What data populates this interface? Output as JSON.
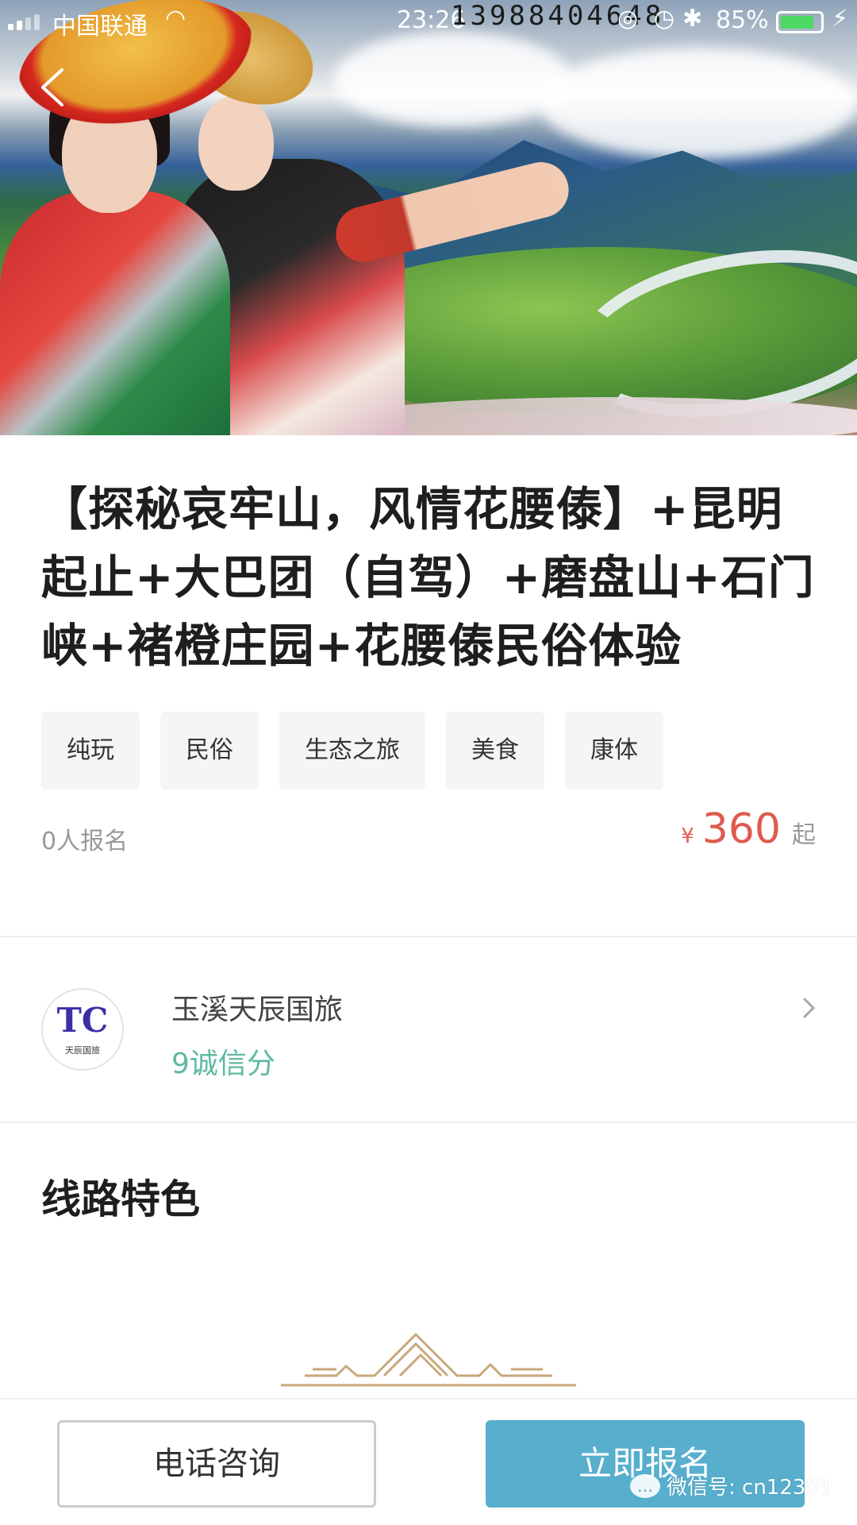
{
  "status_bar": {
    "carrier": "中国联通",
    "time": "23:26",
    "overlay_number": "13988404648",
    "battery": "85%",
    "battery_level": 0.85
  },
  "hero": {
    "back_icon": "chevron-left-icon"
  },
  "product": {
    "title": "【探秘哀牢山，风情花腰傣】+昆明起止+大巴团（自驾）+磨盘山+石门峡+褚橙庄园+花腰傣民俗体验",
    "tags": [
      "纯玩",
      "民俗",
      "生态之旅",
      "美食",
      "康体"
    ],
    "signup_count": "0人报名",
    "price": {
      "currency": "¥",
      "amount": "360",
      "suffix": "起"
    }
  },
  "agency": {
    "name": "玉溪天辰国旅",
    "score": "9诚信分",
    "logo_text": "天辰国旅",
    "logo_mark": "TC",
    "chevron_icon": "chevron-right-icon"
  },
  "features": {
    "title": "线路特色"
  },
  "bottom_bar": {
    "consult_label": "电话咨询",
    "signup_label": "立即报名"
  },
  "watermark": {
    "text": "微信号: cn12301"
  },
  "colors": {
    "price": "#e05a4e",
    "score": "#5fb9a2",
    "primary_button": "#57aecd",
    "tag_bg": "#f5f5f5"
  }
}
